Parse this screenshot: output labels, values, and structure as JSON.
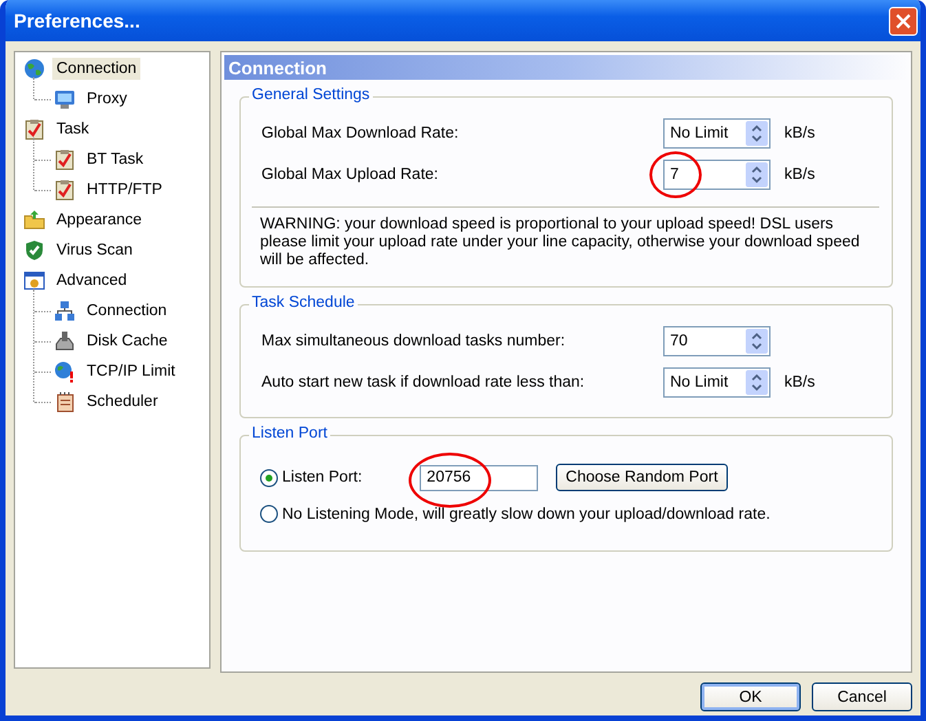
{
  "window": {
    "title": "Preferences..."
  },
  "sidebar": {
    "items": [
      {
        "label": "Connection",
        "selected": true,
        "children": [
          {
            "label": "Proxy",
            "selected": false
          }
        ]
      },
      {
        "label": "Task",
        "selected": false,
        "children": [
          {
            "label": "BT Task",
            "selected": false
          },
          {
            "label": "HTTP/FTP",
            "selected": false
          }
        ]
      },
      {
        "label": "Appearance",
        "selected": false
      },
      {
        "label": "Virus Scan",
        "selected": false
      },
      {
        "label": "Advanced",
        "selected": false,
        "children": [
          {
            "label": "Connection",
            "selected": false
          },
          {
            "label": "Disk Cache",
            "selected": false
          },
          {
            "label": "TCP/IP Limit",
            "selected": false
          },
          {
            "label": "Scheduler",
            "selected": false
          }
        ]
      }
    ]
  },
  "panel": {
    "title": "Connection",
    "groups": [
      {
        "title": "General Settings",
        "rows": [
          {
            "label": "Global Max Download Rate:",
            "value": "No Limit",
            "unit": "kB/s",
            "highlighted": false
          },
          {
            "label": "Global Max Upload Rate:",
            "value": "7",
            "unit": "kB/s",
            "highlighted": true
          }
        ],
        "note": "WARNING: your download speed is proportional to your upload speed! DSL users please limit your upload rate under your line capacity, otherwise your download speed will be affected."
      },
      {
        "title": "Task Schedule",
        "rows": [
          {
            "label": "Max simultaneous download tasks number:",
            "value": "70",
            "highlighted": false
          },
          {
            "label": "Auto start new task if download rate less than:",
            "value": "No Limit",
            "unit": "kB/s",
            "highlighted": false
          }
        ]
      }
    ],
    "listen_port": {
      "title": "Listen Port",
      "options": [
        {
          "label": "Listen Port:",
          "selected": true,
          "value": "20756",
          "highlighted": true,
          "button": "Choose Random Port"
        },
        {
          "label": "No Listening Mode, will greatly slow down your upload/download rate.",
          "selected": false
        }
      ]
    }
  },
  "buttons": [
    {
      "label": "OK",
      "default": true
    },
    {
      "label": "Cancel",
      "default": false
    }
  ]
}
